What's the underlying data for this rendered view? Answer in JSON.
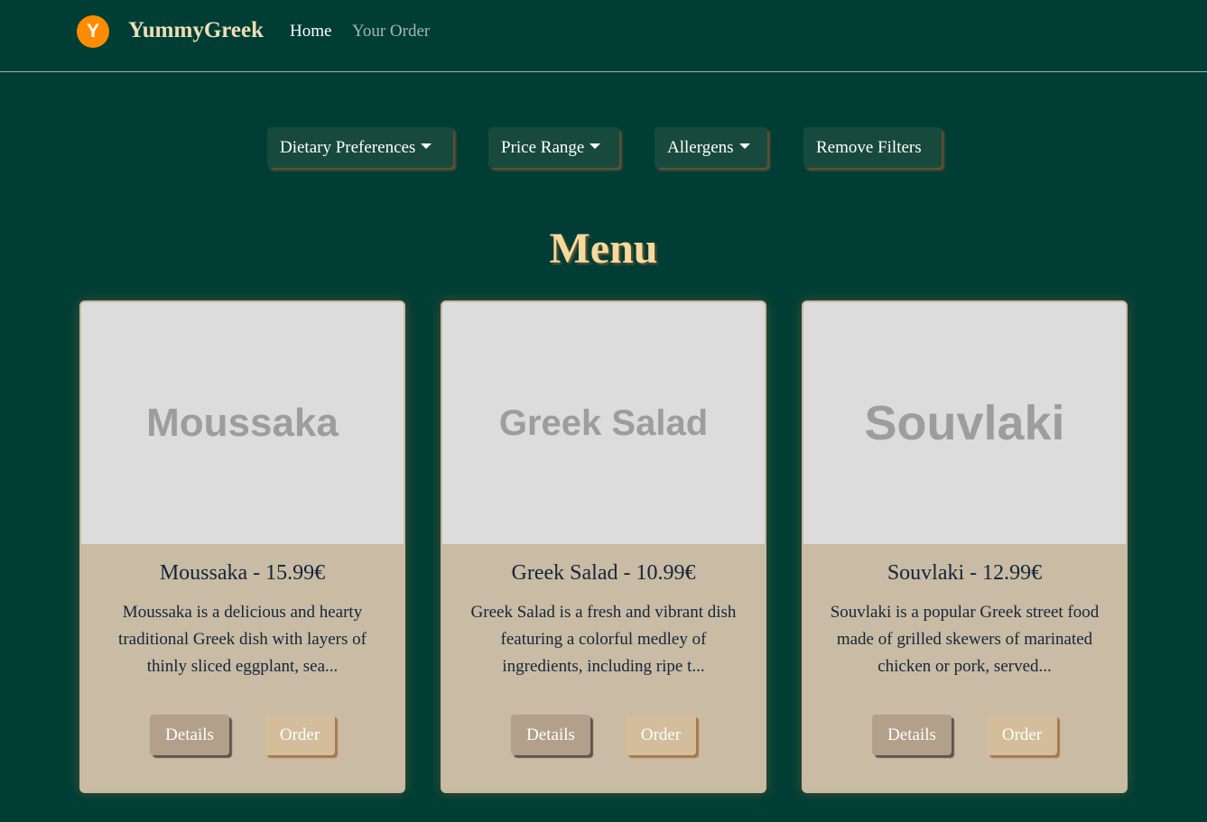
{
  "brand": {
    "logo_letter": "Y",
    "name": "YummyGreek"
  },
  "nav": {
    "home": "Home",
    "your_order": "Your Order"
  },
  "filters": {
    "dietary": "Dietary Preferences",
    "price": "Price Range",
    "allergens": "Allergens",
    "remove": "Remove Filters"
  },
  "menu_title": "Menu",
  "cards": [
    {
      "image_text": "Moussaka",
      "title": "Moussaka - 15.99€",
      "description": "Moussaka is a delicious and hearty traditional Greek dish with layers of thinly sliced eggplant, sea...",
      "details": "Details",
      "order": "Order"
    },
    {
      "image_text": "Greek Salad",
      "title": "Greek Salad - 10.99€",
      "description": "Greek Salad is a fresh and vibrant dish featuring a colorful medley of ingredients, including ripe t...",
      "details": "Details",
      "order": "Order"
    },
    {
      "image_text": "Souvlaki",
      "title": "Souvlaki - 12.99€",
      "description": "Souvlaki is a popular Greek street food made of grilled skewers of marinated chicken or pork, served...",
      "details": "Details",
      "order": "Order"
    }
  ],
  "colors": {
    "background": "#003e35",
    "brand_text": "#f0deb6",
    "logo": "#ff8c00",
    "menu_title": "#f5d99f",
    "card_body": "#c9bba4",
    "details_button": "#b2a08b",
    "order_button": "#d3bd9b"
  },
  "icons": {
    "logo": "brand-logo-icon",
    "filter_caret": "caret-down-icon"
  }
}
